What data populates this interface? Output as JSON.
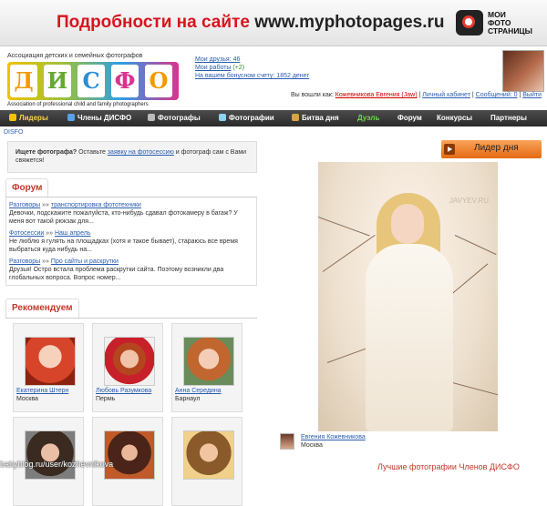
{
  "banner": {
    "text_prefix": "Подробности на сайте ",
    "text_site": "www.myphotopages.ru",
    "logo_text": [
      "МОИ",
      "ФОТО",
      "СТРАНИЦЫ"
    ]
  },
  "header": {
    "assoc_ru": "Ассоциация детских и семейных фотографов",
    "logo_letters": [
      "Д",
      "И",
      "С",
      "Ф",
      "О"
    ],
    "assoc_en": "Association of professional child and family photographers",
    "links": {
      "friends": "Мои друзья: 46",
      "works_label": "Мои работы",
      "works_count": "(+2)",
      "bonus": "На вашем бонусном счету: 1852 денег"
    },
    "login": {
      "prefix": "Вы вошли как:",
      "user": "Кожевникова Евгения (Jaw)",
      "cabinet": "Личный кабинет",
      "messages": "Сообщений: 0",
      "logout": "Выйти"
    }
  },
  "nav": {
    "items": [
      "Лидеры",
      "Члены ДИСФО",
      "Фотографы",
      "Фотографии",
      "Битва дня",
      "Дуэль",
      "Форум",
      "Конкурсы",
      "Партнеры"
    ]
  },
  "breadcrumb": "DISFO",
  "seek": {
    "bold": "Ищете фотографа?",
    "pre": " Оставьте ",
    "link": "заявку на фотосессию",
    "post": " и фотограф сам с Вами свяжется!"
  },
  "forum": {
    "tab": "Форум",
    "items": [
      {
        "cat": "Разговоры",
        "sep": " »» ",
        "topic": "транспортировка фототехники",
        "text": "Девочки, подскажите пожалуйста, кто-нибудь сдавал фотокамеру в багаж? У меня вот такой рюкзак для..."
      },
      {
        "cat": "Фотосессии",
        "sep": " »» ",
        "topic": "Наш апрель",
        "text": "Не люблю я гулять на площадках (хотя и такое бывает), стараюсь все время выбраться куда нибудь на..."
      },
      {
        "cat": "Разговоры",
        "sep": " »» ",
        "topic": "Про сайты и раскрутки",
        "text": "Друзья! Остро встала проблема раскрутки сайта. Поэтому возникли два глобальных вопроса. Вопрос номер..."
      }
    ]
  },
  "recommend": {
    "tab": "Рекомендуем",
    "cards": [
      {
        "name": "Екатерина Штерн",
        "city": "Москва"
      },
      {
        "name": "Любовь Разумкова",
        "city": "Пермь"
      },
      {
        "name": "Анна Середина",
        "city": "Барнаул"
      },
      {
        "name": "",
        "city": ""
      },
      {
        "name": "",
        "city": ""
      },
      {
        "name": "",
        "city": ""
      }
    ]
  },
  "leader": {
    "button": "Лидер дня",
    "watermark": "JAVYEV.RU",
    "winner_name": "Евгения Кожевникова",
    "winner_city": "Москва"
  },
  "best_label": "Лучшие фотографии Членов ДИСФО",
  "bottom_watermark": "babyblog.ru/user/kozhevnikova",
  "colors": {
    "accent_red": "#d8141e",
    "nav_bg": "#333333",
    "link": "#2a5db0",
    "leader_orange": "#e46a12",
    "duel_green": "#6fd84f"
  }
}
